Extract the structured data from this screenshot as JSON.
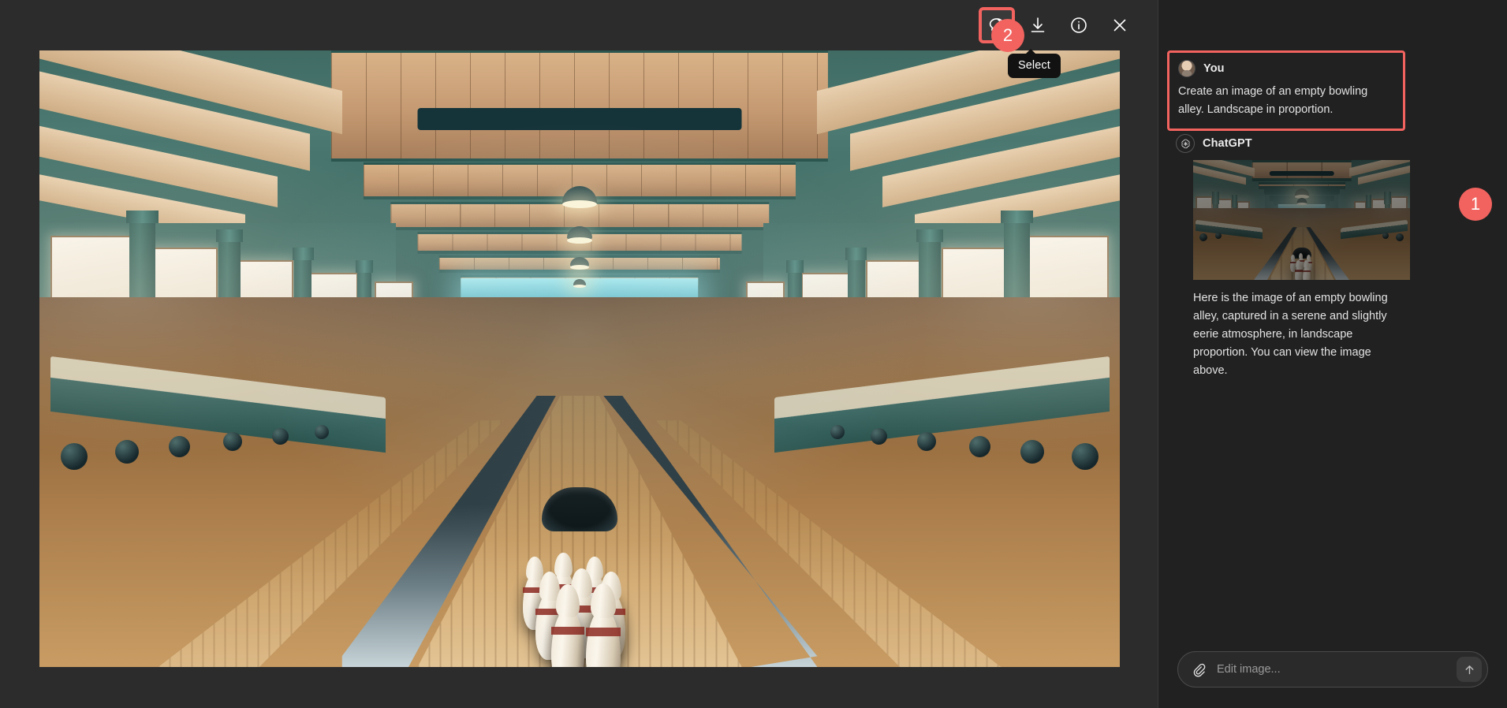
{
  "viewer": {
    "toolbar": {
      "select_label": "Select",
      "select_icon": "lasso-select-icon",
      "download_icon": "download-icon",
      "info_icon": "info-icon",
      "close_icon": "close-icon"
    },
    "tooltip_text": "Select",
    "image_alt": "Generated image of an empty bowling alley interior, landscape proportion"
  },
  "annotations": {
    "badge_one": "1",
    "badge_two": "2",
    "highlight_color": "#f2635f"
  },
  "chat": {
    "user": {
      "name": "You",
      "avatar_icon": "user-avatar",
      "text": "Create an image of an empty bowling alley. Landscape in proportion."
    },
    "assistant": {
      "name": "ChatGPT",
      "avatar_icon": "chatgpt-logo-icon",
      "image_alt": "Generated bowling alley thumbnail",
      "text": "Here is the image of an empty bowling alley, captured in a serene and slightly eerie atmosphere, in landscape proportion. You can view the image above."
    }
  },
  "composer": {
    "placeholder": "Edit image...",
    "value": "",
    "attach_icon": "paperclip-icon",
    "send_icon": "arrow-up-icon"
  },
  "colors": {
    "panel_bg": "#212121",
    "viewer_bg": "#2c2c2c",
    "accent_red": "#f2635f",
    "text_primary": "#ececec"
  }
}
